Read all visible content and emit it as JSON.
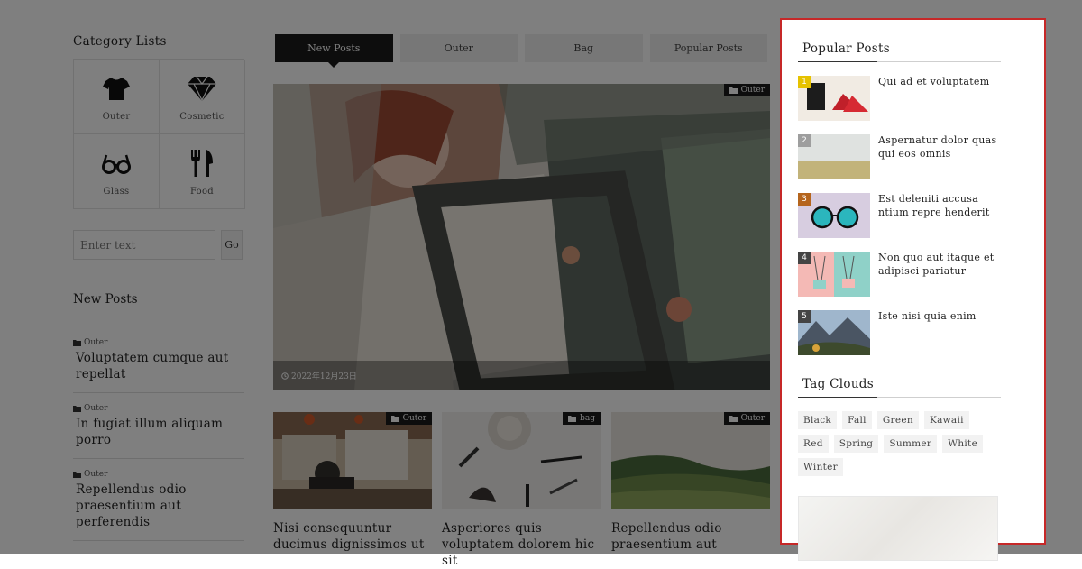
{
  "category_lists": {
    "heading": "Category Lists",
    "items": [
      {
        "label": "Outer",
        "icon": "tshirt-icon"
      },
      {
        "label": "Cosmetic",
        "icon": "diamond-icon"
      },
      {
        "label": "Glass",
        "icon": "glasses-icon"
      },
      {
        "label": "Food",
        "icon": "fork-knife-icon"
      }
    ]
  },
  "search": {
    "placeholder": "Enter text",
    "button_label": "Go"
  },
  "new_posts": {
    "heading": "New Posts",
    "items": [
      {
        "category": "Outer",
        "title": "Voluptatem cumque aut repellat"
      },
      {
        "category": "Outer",
        "title": "In fugiat illum aliquam porro"
      },
      {
        "category": "Outer",
        "title": "Repellendus odio praesentium aut perferendis"
      }
    ]
  },
  "tabs": [
    {
      "label": "New Posts",
      "active": true
    },
    {
      "label": "Outer"
    },
    {
      "label": "Bag"
    },
    {
      "label": "Popular Posts"
    }
  ],
  "hero": {
    "badge": "Outer",
    "date": "2022年12月23日"
  },
  "cards": [
    {
      "badge": "Outer",
      "title": "Nisi consequuntur ducimus dignissimos ut"
    },
    {
      "badge": "bag",
      "title": "Asperiores quis voluptatem dolorem hic sit"
    },
    {
      "badge": "Outer",
      "title": "Repellendus odio praesentium aut"
    }
  ],
  "popular_posts": {
    "heading": "Popular Posts",
    "items": [
      {
        "rank": "1",
        "title": "Qui ad et voluptatem",
        "rank_color": "#e6c200"
      },
      {
        "rank": "2",
        "title": "Aspernatur dolor quas qui eos omnis",
        "rank_color": "#9e9e9e"
      },
      {
        "rank": "3",
        "title": "Est deleniti accusa ntium repre henderit",
        "rank_color": "#b5651d"
      },
      {
        "rank": "4",
        "title": "Non quo aut itaque et adipisci pariatur",
        "rank_color": "#444444"
      },
      {
        "rank": "5",
        "title": "Iste nisi quia enim",
        "rank_color": "#444444"
      }
    ]
  },
  "tag_clouds": {
    "heading": "Tag Clouds",
    "tags": [
      "Black",
      "Fall",
      "Green",
      "Kawaii",
      "Red",
      "Spring",
      "Summer",
      "White",
      "Winter"
    ]
  },
  "colors": {
    "accent_dark": "#1a1a1a",
    "highlight_border": "#c62828",
    "overlay": "rgba(0,0,0,0.5)"
  }
}
